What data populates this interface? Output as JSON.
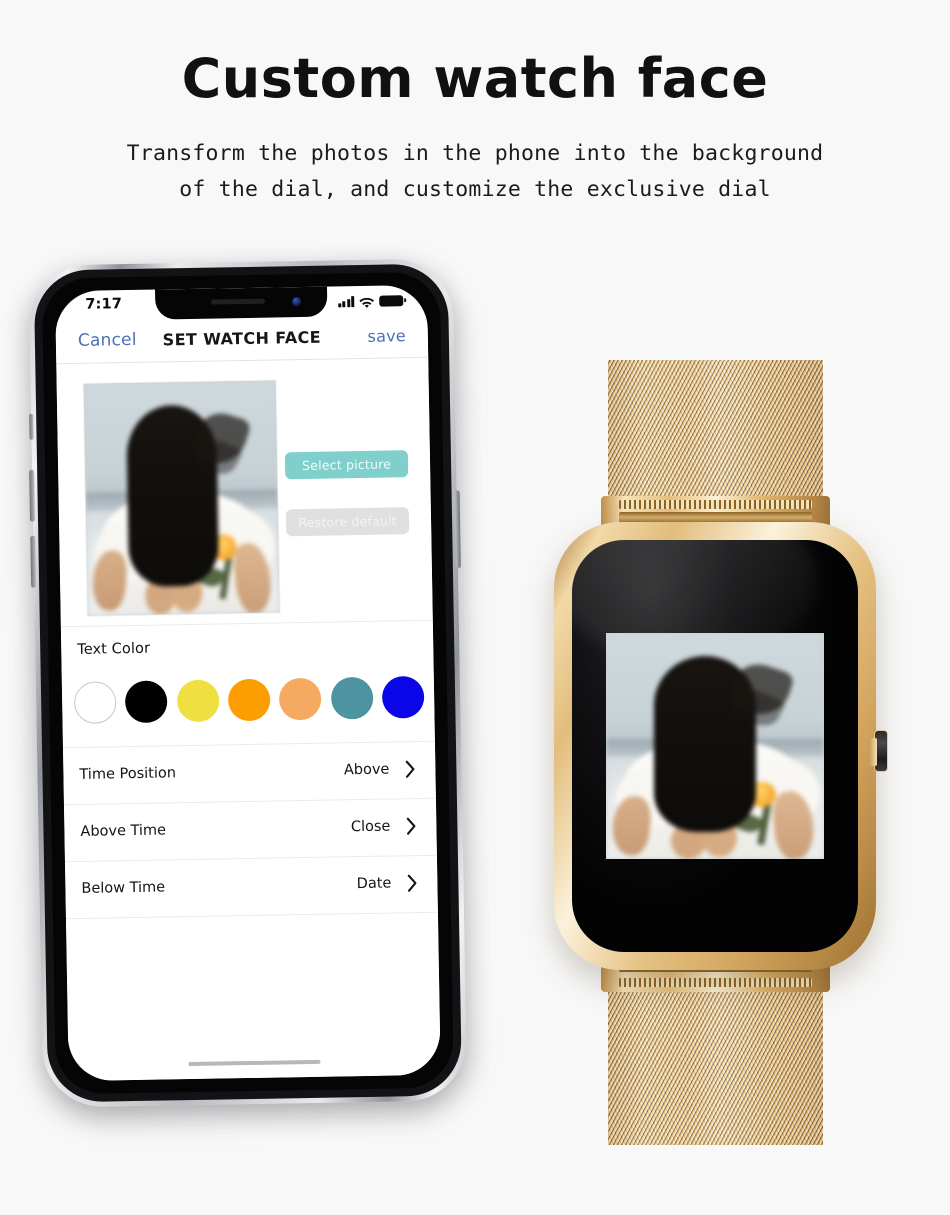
{
  "page": {
    "background_color": "#f8f8f8",
    "title": "Custom watch face",
    "subtitle_line1": "Transform the photos in the phone into the background",
    "subtitle_line2": "of the dial, and customize the exclusive dial"
  },
  "phone": {
    "status_bar": {
      "time": "7:17",
      "signal_icon": "signal-bars-icon",
      "wifi_icon": "wifi-icon",
      "battery_icon": "battery-icon"
    },
    "nav_bar": {
      "cancel_label": "Cancel",
      "title": "SET WATCH FACE",
      "save_label": "save",
      "link_color": "#4b6fb5"
    },
    "preview": {
      "photo_alt": "woman-with-flower-photo",
      "select_picture_label": "Select picture",
      "select_picture_color": "#7fd0cc",
      "restore_default_label": "Restore default",
      "restore_default_color": "#e0e0e0"
    },
    "text_color": {
      "label": "Text Color",
      "swatches": [
        {
          "name": "white",
          "hex": "#ffffff",
          "selected": true
        },
        {
          "name": "black",
          "hex": "#000000",
          "selected": false
        },
        {
          "name": "yellow",
          "hex": "#f0df40",
          "selected": false
        },
        {
          "name": "orange",
          "hex": "#fc9d02",
          "selected": false
        },
        {
          "name": "light-orange",
          "hex": "#f5a961",
          "selected": false
        },
        {
          "name": "teal",
          "hex": "#4d94a0",
          "selected": false
        },
        {
          "name": "blue",
          "hex": "#0a06e8",
          "selected": false
        }
      ]
    },
    "settings_rows": [
      {
        "label": "Time Position",
        "value": "Above"
      },
      {
        "label": "Above Time",
        "value": "Close"
      },
      {
        "label": "Below Time",
        "value": "Date"
      }
    ],
    "home_indicator": "home-indicator"
  },
  "watch": {
    "case_color": "#e2bd7c",
    "band_style": "milanese-mesh",
    "band_color": "#d9ac68",
    "screen_color": "#030304",
    "dial_photo_alt": "woman-with-flower-photo",
    "crown_icon": "crown-button-icon"
  }
}
